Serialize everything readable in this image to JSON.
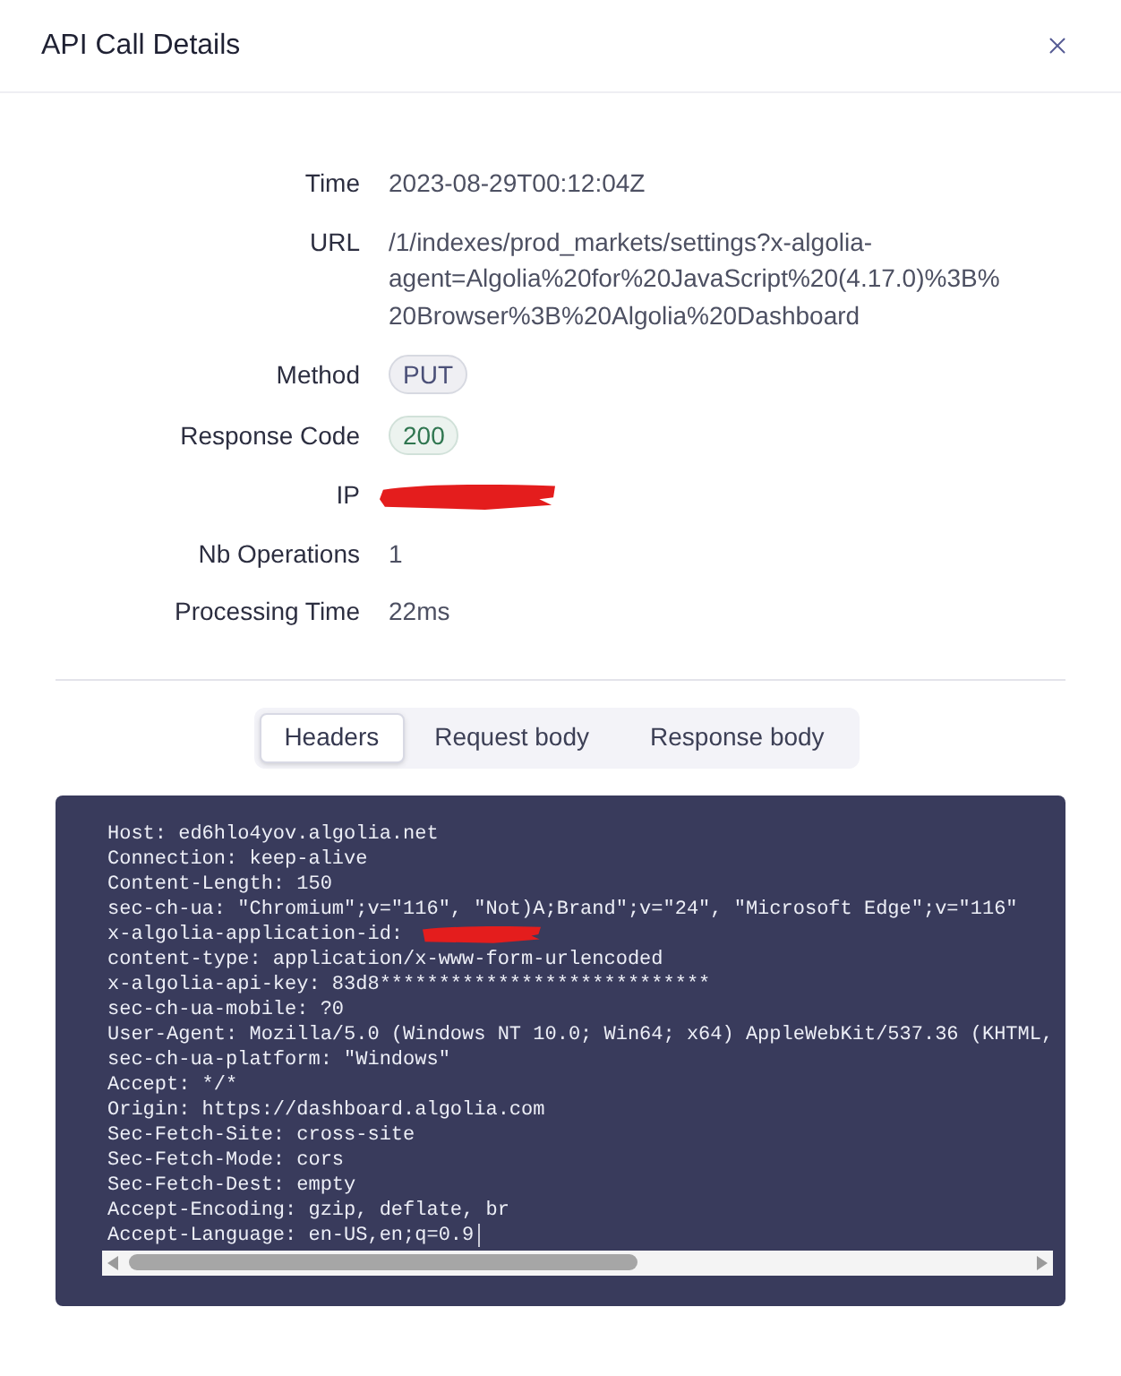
{
  "dialog": {
    "title": "API Call Details"
  },
  "details": [
    {
      "label": "Time",
      "kind": "text",
      "value": "2023-08-29T00:12:04Z"
    },
    {
      "label": "URL",
      "kind": "text",
      "value": "/1/indexes/prod_markets/settings?x-algolia-agent=Algolia%20for%20JavaScript%20(4.17.0)%3B%20Browser%3B%20Algolia%20Dashboard"
    },
    {
      "label": "Method",
      "kind": "badge",
      "value": "PUT",
      "color": "#4b5078"
    },
    {
      "label": "Response Code",
      "kind": "badge",
      "value": "200",
      "color": "#2f7650"
    },
    {
      "label": "IP",
      "kind": "redacted"
    },
    {
      "label": "Nb Operations",
      "kind": "text",
      "value": "1"
    },
    {
      "label": "Processing Time",
      "kind": "text",
      "value": "22ms"
    }
  ],
  "tabs": [
    {
      "label": "Headers",
      "selected": true
    },
    {
      "label": "Request body",
      "selected": false
    },
    {
      "label": "Response body",
      "selected": false
    }
  ],
  "code": {
    "cursor": true,
    "lines": [
      {
        "text": "Host: ed6hlo4yov.algolia.net",
        "redacted": false
      },
      {
        "text": "Connection: keep-alive",
        "redacted": false
      },
      {
        "text": "Content-Length: 150",
        "redacted": false
      },
      {
        "text": "sec-ch-ua: \"Chromium\";v=\"116\", \"Not)A;Brand\";v=\"24\", \"Microsoft Edge\";v=\"116\"",
        "redacted": false
      },
      {
        "text": "x-algolia-application-id:",
        "redacted": true
      },
      {
        "text": "content-type: application/x-www-form-urlencoded",
        "redacted": false
      },
      {
        "text": "x-algolia-api-key: 83d8****************************",
        "redacted": false
      },
      {
        "text": "sec-ch-ua-mobile: ?0",
        "redacted": false
      },
      {
        "text": "User-Agent: Mozilla/5.0 (Windows NT 10.0; Win64; x64) AppleWebKit/537.36 (KHTML,",
        "redacted": false
      },
      {
        "text": "sec-ch-ua-platform: \"Windows\"",
        "redacted": false
      },
      {
        "text": "Accept: */*",
        "redacted": false
      },
      {
        "text": "Origin: https://dashboard.algolia.com",
        "redacted": false
      },
      {
        "text": "Sec-Fetch-Site: cross-site",
        "redacted": false
      },
      {
        "text": "Sec-Fetch-Mode: cors",
        "redacted": false
      },
      {
        "text": "Sec-Fetch-Dest: empty",
        "redacted": false
      },
      {
        "text": "Accept-Encoding: gzip, deflate, br",
        "redacted": false
      },
      {
        "text": "Accept-Language: en-US,en;q=0.9",
        "redacted": false
      }
    ]
  }
}
